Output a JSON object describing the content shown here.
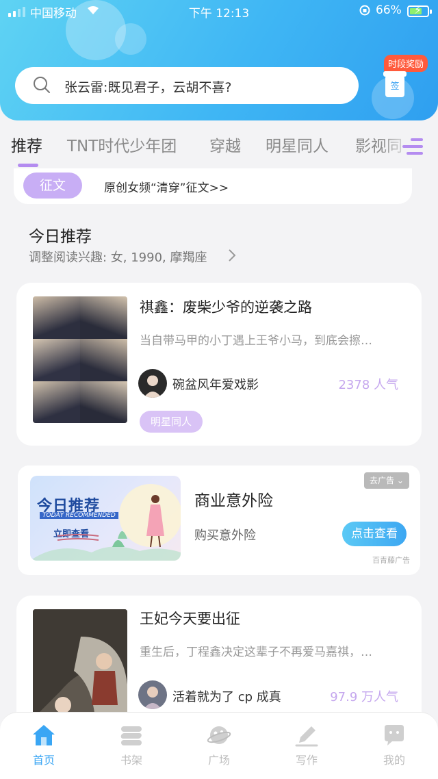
{
  "status_bar": {
    "carrier": "中国移动",
    "time": "下午 12:13",
    "battery": "66%"
  },
  "search": {
    "placeholder": "张云雷:既见君子，云胡不喜?"
  },
  "reward_badge": "时段奖励",
  "reward_sign": "签",
  "tabs": [
    "推荐",
    "TNT时代少年团",
    "穿越",
    "明星同人",
    "影视同"
  ],
  "banner": {
    "tag": "征文",
    "text": "原创女频“清穿”征文>>"
  },
  "today": {
    "title": "今日推荐",
    "subtitle": "调整阅读兴趣: 女, 1990, 摩羯座"
  },
  "books": [
    {
      "title": "祺鑫：废柴少爷的逆袭之路",
      "desc": "当自带马甲的小丁遇上王爷小马，到底会擦…",
      "author": "碗盆风年爱戏影",
      "popularity": "2378 人气",
      "tag": "明星同人"
    },
    {
      "title": "王妃今天要出征",
      "desc": "重生后，丁程鑫决定这辈子不再爱马嘉祺，…",
      "author": "活着就为了 cp 成真",
      "popularity": "97.9 万人气"
    }
  ],
  "ad": {
    "image_title": "今日推荐",
    "image_subtitle": "TODAY RECOMMENDED",
    "image_cta": "立即查看",
    "title": "商业意外险",
    "description": "购买意外险",
    "close_label": "去广告 ⌄",
    "button_label": "点击查看",
    "source": "百青藤广告"
  },
  "bottom_nav": [
    {
      "label": "首页",
      "icon": "home-icon",
      "active": true
    },
    {
      "label": "书架",
      "icon": "bookshelf-icon",
      "active": false
    },
    {
      "label": "广场",
      "icon": "planet-icon",
      "active": false
    },
    {
      "label": "写作",
      "icon": "pen-icon",
      "active": false
    },
    {
      "label": "我的",
      "icon": "chat-bubble-icon",
      "active": false
    }
  ],
  "colors": {
    "header_blue": "#3fb6f4",
    "accent_purple": "#b48cf0",
    "active_nav": "#3aa6f4"
  }
}
